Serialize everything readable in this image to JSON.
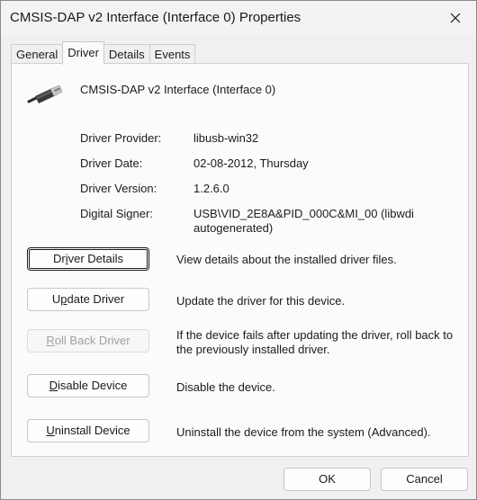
{
  "window": {
    "title": "CMSIS-DAP v2 Interface (Interface 0) Properties"
  },
  "tabs": [
    {
      "label": "General",
      "active": false
    },
    {
      "label": "Driver",
      "active": true
    },
    {
      "label": "Details",
      "active": false
    },
    {
      "label": "Events",
      "active": false
    }
  ],
  "device": {
    "name": "CMSIS-DAP v2 Interface (Interface 0)",
    "icon": "usb-plug-icon"
  },
  "info": {
    "provider_label": "Driver Provider:",
    "provider_value": "libusb-win32",
    "date_label": "Driver Date:",
    "date_value": "02-08-2012, Thursday",
    "version_label": "Driver Version:",
    "version_value": "1.2.6.0",
    "signer_label": "Digital Signer:",
    "signer_value": "USB\\VID_2E8A&PID_000C&MI_00 (libwdi autogenerated)"
  },
  "actions": {
    "details_pre": "Dr",
    "details_key": "i",
    "details_post": "ver Details",
    "details_desc": "View details about the installed driver files.",
    "update_pre": "U",
    "update_key": "p",
    "update_post": "date Driver",
    "update_desc": "Update the driver for this device.",
    "rollback_pre": "",
    "rollback_key": "R",
    "rollback_post": "oll Back Driver",
    "rollback_desc": "If the device fails after updating the driver, roll back to the previously installed driver.",
    "disable_pre": "",
    "disable_key": "D",
    "disable_post": "isable Device",
    "disable_desc": "Disable the device.",
    "uninstall_pre": "",
    "uninstall_key": "U",
    "uninstall_post": "ninstall Device",
    "uninstall_desc": "Uninstall the device from the system (Advanced)."
  },
  "footer": {
    "ok_label": "OK",
    "cancel_label": "Cancel"
  },
  "colors": {
    "background": "#f0f0f0",
    "panel": "#fbfbfb",
    "disabled_text": "#a0a0a0"
  }
}
